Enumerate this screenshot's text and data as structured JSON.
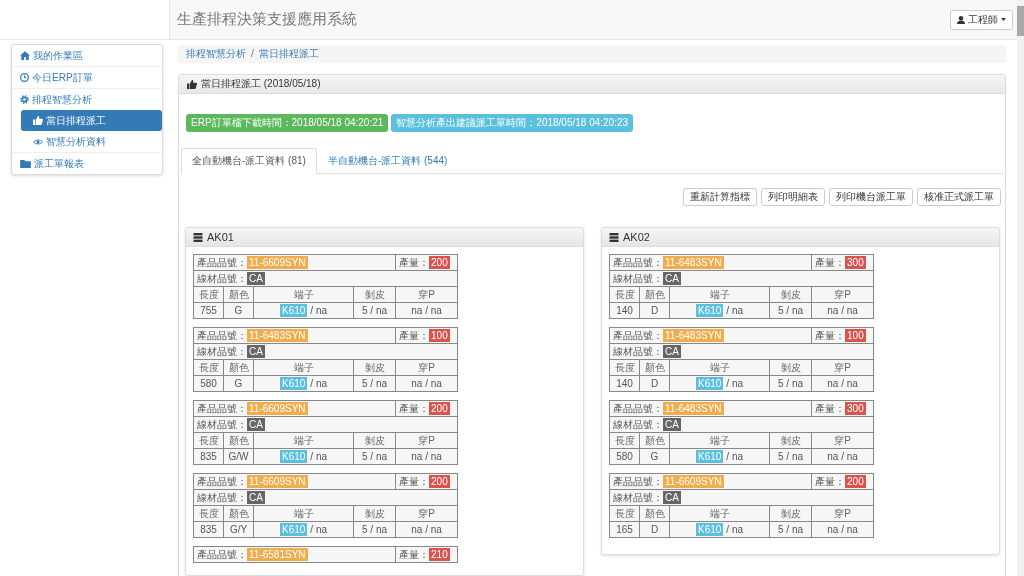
{
  "navbar": {
    "title": "生產排程決策支援應用系統",
    "user_menu": {
      "label": "工程師"
    }
  },
  "sidebar": {
    "items": [
      {
        "label": "我的作業區",
        "selected": false
      },
      {
        "label": "今日ERP訂單",
        "selected": false
      },
      {
        "label": "排程智慧分析",
        "selected": false,
        "children": [
          {
            "label": "當日排程派工",
            "selected": true
          },
          {
            "label": "智慧分析資料",
            "selected": false
          }
        ]
      },
      {
        "label": "派工單報表",
        "selected": false
      }
    ]
  },
  "breadcrumb": {
    "separator": "/",
    "items": [
      {
        "label": "排程智慧分析"
      },
      {
        "label": "當日排程派工"
      }
    ]
  },
  "panel": {
    "title": "當日排程派工 (2018/05/18)",
    "timestamps": [
      {
        "text": "ERP訂單檔下載時間：2018/05/18 04:20:21",
        "color": "#5cb85c"
      },
      {
        "text": "智慧分析產出建議派工單時間：2018/05/18 04:20:23",
        "color": "#5bc0de"
      }
    ],
    "tabs": [
      {
        "label": "全自動機台-派工資料 (81)",
        "selected": true
      },
      {
        "label": "半自動機台-派工資料 (544)",
        "selected": false
      }
    ],
    "actions": [
      "重新計算指標",
      "列印明細表",
      "列印機台派工單",
      "核准正式派工單"
    ],
    "machines": [
      {
        "name": "AK01",
        "orders": [
          {
            "product": {
              "caption": "產品品號：",
              "code": "11-6609SYN"
            },
            "quantity": {
              "caption": "產量：",
              "value": "200"
            },
            "wire": {
              "caption": "線材品號：",
              "code": "CA"
            },
            "columns": [
              "長度",
              "顏色",
              "端子",
              "剝皮",
              "穿P"
            ],
            "specs": {
              "length": "755",
              "color_code": "G",
              "terminal": "K610",
              "terminal_note": "/ na",
              "strip": "5 / na",
              "punch": "na / na"
            }
          },
          {
            "product": {
              "caption": "產品品號：",
              "code": "11-6483SYN"
            },
            "quantity": {
              "caption": "產量：",
              "value": "100"
            },
            "wire": {
              "caption": "線材品號：",
              "code": "CA"
            },
            "columns": [
              "長度",
              "顏色",
              "端子",
              "剝皮",
              "穿P"
            ],
            "specs": {
              "length": "580",
              "color_code": "G",
              "terminal": "K610",
              "terminal_note": "/ na",
              "strip": "5 / na",
              "punch": "na / na"
            }
          },
          {
            "product": {
              "caption": "產品品號：",
              "code": "11-6609SYN"
            },
            "quantity": {
              "caption": "產量：",
              "value": "200"
            },
            "wire": {
              "caption": "線材品號：",
              "code": "CA"
            },
            "columns": [
              "長度",
              "顏色",
              "端子",
              "剝皮",
              "穿P"
            ],
            "specs": {
              "length": "835",
              "color_code": "G/W",
              "terminal": "K610",
              "terminal_note": "/ na",
              "strip": "5 / na",
              "punch": "na / na"
            }
          },
          {
            "product": {
              "caption": "產品品號：",
              "code": "11-6609SYN"
            },
            "quantity": {
              "caption": "產量：",
              "value": "200"
            },
            "wire": {
              "caption": "線材品號：",
              "code": "CA"
            },
            "columns": [
              "長度",
              "顏色",
              "端子",
              "剝皮",
              "穿P"
            ],
            "specs": {
              "length": "835",
              "color_code": "G/Y",
              "terminal": "K610",
              "terminal_note": "/ na",
              "strip": "5 / na",
              "punch": "na / na"
            }
          },
          {
            "product": {
              "caption": "產品品號：",
              "code": "11-6581SYN"
            },
            "quantity": {
              "caption": "產量：",
              "value": "210"
            }
          }
        ]
      },
      {
        "name": "AK02",
        "orders": [
          {
            "product": {
              "caption": "產品品號：",
              "code": "11-6483SYN"
            },
            "quantity": {
              "caption": "產量：",
              "value": "300"
            },
            "wire": {
              "caption": "線材品號：",
              "code": "CA"
            },
            "columns": [
              "長度",
              "顏色",
              "端子",
              "剝皮",
              "穿P"
            ],
            "specs": {
              "length": "140",
              "color_code": "D",
              "terminal": "K610",
              "terminal_note": "/ na",
              "strip": "5 / na",
              "punch": "na / na"
            }
          },
          {
            "product": {
              "caption": "產品品號：",
              "code": "11-6483SYN"
            },
            "quantity": {
              "caption": "產量：",
              "value": "100"
            },
            "wire": {
              "caption": "線材品號：",
              "code": "CA"
            },
            "columns": [
              "長度",
              "顏色",
              "端子",
              "剝皮",
              "穿P"
            ],
            "specs": {
              "length": "140",
              "color_code": "D",
              "terminal": "K610",
              "terminal_note": "/ na",
              "strip": "5 / na",
              "punch": "na / na"
            }
          },
          {
            "product": {
              "caption": "產品品號：",
              "code": "11-6483SYN"
            },
            "quantity": {
              "caption": "產量：",
              "value": "300"
            },
            "wire": {
              "caption": "線材品號：",
              "code": "CA"
            },
            "columns": [
              "長度",
              "顏色",
              "端子",
              "剝皮",
              "穿P"
            ],
            "specs": {
              "length": "580",
              "color_code": "G",
              "terminal": "K610",
              "terminal_note": "/ na",
              "strip": "5 / na",
              "punch": "na / na"
            }
          },
          {
            "product": {
              "caption": "產品品號：",
              "code": "11-6609SYN"
            },
            "quantity": {
              "caption": "產量：",
              "value": "200"
            },
            "wire": {
              "caption": "線材品號：",
              "code": "CA"
            },
            "columns": [
              "長度",
              "顏色",
              "端子",
              "剝皮",
              "穿P"
            ],
            "specs": {
              "length": "165",
              "color_code": "D",
              "terminal": "K610",
              "terminal_note": "/ na",
              "strip": "5 / na",
              "punch": "na / na"
            }
          }
        ]
      }
    ]
  }
}
